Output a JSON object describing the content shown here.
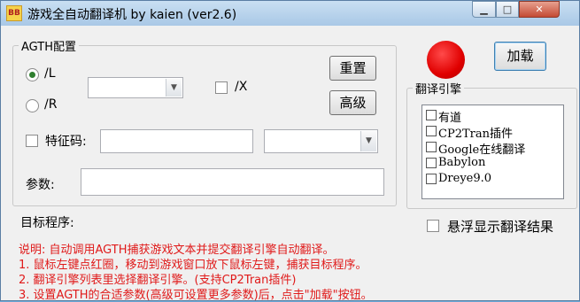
{
  "window": {
    "title": "游戏全自动翻译机 by kaien (ver2.6)",
    "icon_text": "BB",
    "min_symbol": "▁",
    "max_symbol": "□",
    "close_symbol": "✕"
  },
  "agth": {
    "group_label": "AGTH配置",
    "radio_l_label": "/L",
    "radio_r_label": "/R",
    "radio_selected": "/L",
    "x_label": "/X",
    "reset_label": "重置",
    "advanced_label": "高级",
    "feature_code_label": "特征码:",
    "params_label": "参数:",
    "feature_code_value": "",
    "params_value": ""
  },
  "controls": {
    "load_label": "加载",
    "status_color": "#e00000"
  },
  "engines": {
    "group_label": "翻译引擎",
    "items": [
      "有道",
      "CP2Tran插件",
      "Google在线翻译",
      "Babylon",
      "Dreye9.0"
    ]
  },
  "floating_label": "悬浮显示翻译结果",
  "target_label": "目标程序:",
  "description": {
    "lines": [
      "说明: 自动调用AGTH捕获游戏文本并提交翻译引擎自动翻译。",
      "1. 鼠标左键点红圈，移动到游戏窗口放下鼠标左键，捕获目标程序。",
      "2. 翻译引擎列表里选择翻译引擎。(支持CP2Tran插件)",
      "3. 设置AGTH的合适参数(高级可设置更多参数)后，点击\"加载\"按钮。"
    ]
  },
  "colors": {
    "accent_red": "#e01a1a",
    "window_bg": "#f0f0f0"
  }
}
